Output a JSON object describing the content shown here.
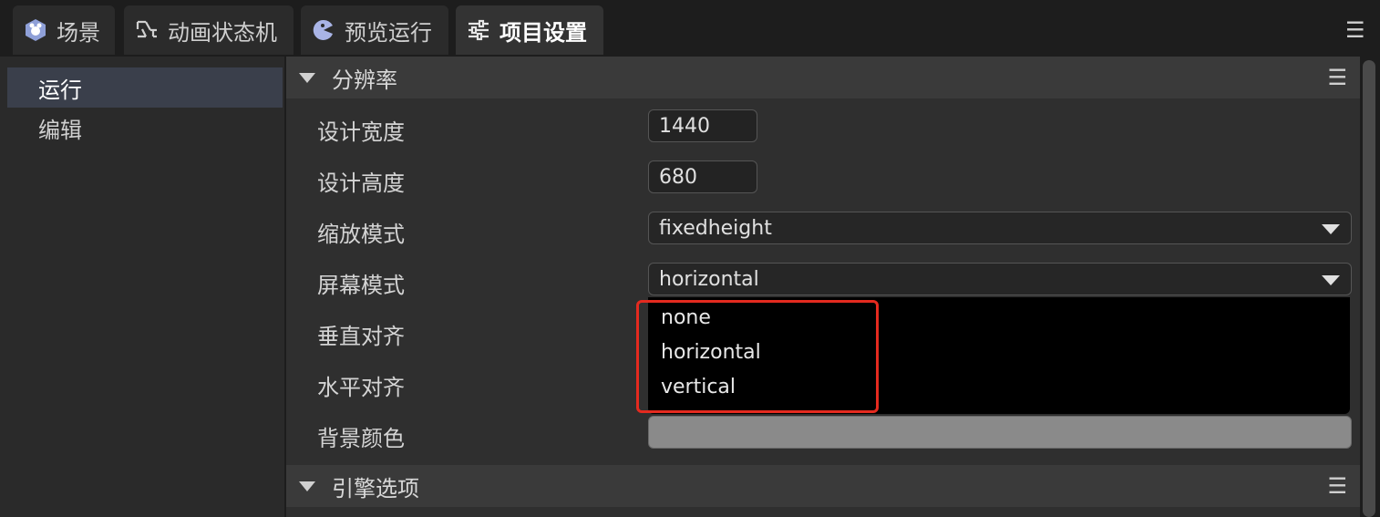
{
  "tabs": [
    {
      "label": "场景",
      "icon": "scene-icon",
      "active": false
    },
    {
      "label": "动画状态机",
      "icon": "state-machine-icon",
      "active": false
    },
    {
      "label": "预览运行",
      "icon": "preview-icon",
      "active": false
    },
    {
      "label": "项目设置",
      "icon": "settings-sliders-icon",
      "active": true
    }
  ],
  "tabbar_menu": "☰",
  "sidebar": {
    "items": [
      {
        "label": "运行",
        "active": true
      },
      {
        "label": "编辑",
        "active": false
      }
    ]
  },
  "sections": {
    "resolution": {
      "title": "分辨率",
      "menu": "☰"
    },
    "engine": {
      "title": "引擎选项",
      "menu": "☰"
    }
  },
  "fields": {
    "design_width": {
      "label": "设计宽度",
      "value": "1440"
    },
    "design_height": {
      "label": "设计高度",
      "value": "680"
    },
    "scale_mode": {
      "label": "缩放模式",
      "value": "fixedheight"
    },
    "screen_mode": {
      "label": "屏幕模式",
      "value": "horizontal"
    },
    "valign": {
      "label": "垂直对齐"
    },
    "halign": {
      "label": "水平对齐"
    },
    "bg_color": {
      "label": "背景颜色",
      "value": "#8a8a8a"
    }
  },
  "dropdown": {
    "options": [
      "none",
      "horizontal",
      "vertical"
    ]
  },
  "colors": {
    "accent_highlight": "#e42a1f",
    "active_tab": "#333333",
    "active_sidebar": "#3a3f4b"
  }
}
